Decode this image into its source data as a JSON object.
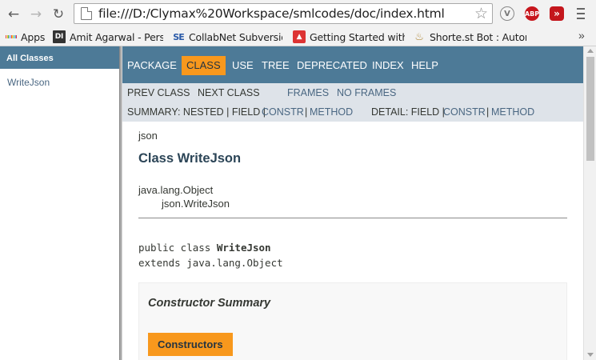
{
  "browser": {
    "url": "file:///D:/Clymax%20Workspace/smlcodes/doc/index.html",
    "nav_icons": [
      "back-arrow-icon",
      "forward-arrow-icon",
      "reload-icon"
    ],
    "extensions": [
      {
        "name": "vimium-icon",
        "label": "V"
      },
      {
        "name": "adblock-plus-icon",
        "label": "ABP"
      },
      {
        "name": "fast-forward-icon",
        "label": "»"
      }
    ]
  },
  "bookmarks": [
    {
      "label": "Apps",
      "icon": "apps-grid-icon"
    },
    {
      "label": "Amit Agarwal - Person",
      "icon": "di-icon",
      "icon_text": "DI"
    },
    {
      "label": "CollabNet Subversion",
      "icon": "se-icon",
      "icon_text": "SE"
    },
    {
      "label": "Getting Started with T",
      "icon": "getting-started-icon"
    },
    {
      "label": "Shorte.st Bot : Autom",
      "icon": "shortest-icon"
    }
  ],
  "left_frame": {
    "header": "All Classes",
    "classes": [
      "WriteJson"
    ]
  },
  "topnav": [
    "PACKAGE",
    "CLASS",
    "USE",
    "TREE",
    "DEPRECATED",
    "INDEX",
    "HELP"
  ],
  "subnav": {
    "prev_class": "PREV CLASS",
    "next_class": "NEXT CLASS",
    "frames": "FRAMES",
    "no_frames": "NO FRAMES",
    "summary_prefix": "SUMMARY: NESTED | FIELD |",
    "summary_constr": "CONSTR",
    "summary_sep": "|",
    "summary_method": "METHOD",
    "detail_prefix": "DETAIL: FIELD |",
    "detail_constr": "CONSTR",
    "detail_sep": "|",
    "detail_method": "METHOD"
  },
  "content": {
    "package": "json",
    "title": "Class WriteJson",
    "inheritance_root": "java.lang.Object",
    "inheritance_child": "json.WriteJson",
    "signature_prefix": "public class ",
    "signature_name": "WriteJson",
    "signature_extends": "extends java.lang.Object",
    "constructor_summary_title": "Constructor Summary",
    "constructors_tab": "Constructors"
  },
  "colors": {
    "nav_bg": "#4d7a97",
    "subnav_bg": "#dee3e9",
    "active_tab": "#f8981d",
    "link": "#4a6782"
  }
}
